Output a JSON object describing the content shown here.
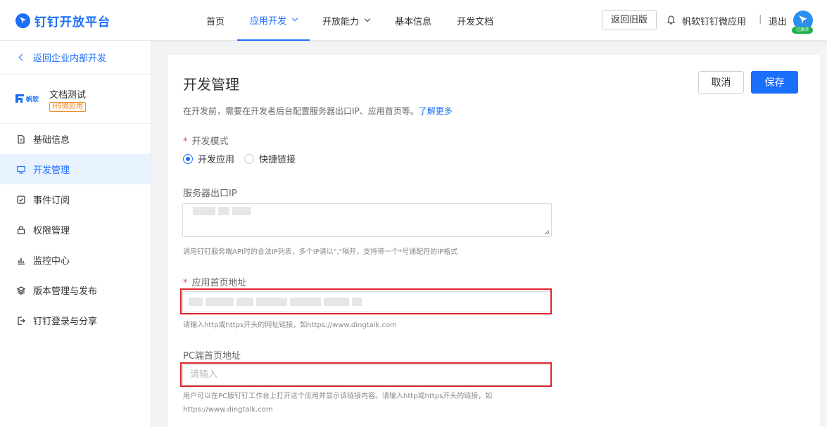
{
  "header": {
    "logo_text": "钉钉开放平台",
    "nav": [
      {
        "label": "首页",
        "active": false,
        "has_dropdown": false
      },
      {
        "label": "应用开发",
        "active": true,
        "has_dropdown": true
      },
      {
        "label": "开放能力",
        "active": false,
        "has_dropdown": true
      },
      {
        "label": "基本信息",
        "active": false,
        "has_dropdown": false
      },
      {
        "label": "开发文档",
        "active": false,
        "has_dropdown": false
      }
    ],
    "old_version_button": "返回旧版",
    "org_name": "帆软钉钉微应用",
    "separator": "|",
    "logout": "退出",
    "avatar_badge": "已激活"
  },
  "sidebar": {
    "back_label": "返回企业内部开发",
    "app": {
      "name": "文档测试",
      "tag": "H5微应用",
      "logo_text": "帆软"
    },
    "items": [
      {
        "label": "基础信息",
        "icon": "document-icon",
        "active": false
      },
      {
        "label": "开发管理",
        "icon": "monitor-icon",
        "active": true
      },
      {
        "label": "事件订阅",
        "icon": "check-square-icon",
        "active": false
      },
      {
        "label": "权限管理",
        "icon": "lock-icon",
        "active": false
      },
      {
        "label": "监控中心",
        "icon": "bar-chart-icon",
        "active": false
      },
      {
        "label": "版本管理与发布",
        "icon": "layers-icon",
        "active": false
      },
      {
        "label": "钉钉登录与分享",
        "icon": "share-icon",
        "active": false
      }
    ]
  },
  "main": {
    "title": "开发管理",
    "cancel_label": "取消",
    "save_label": "保存",
    "description": "在开发前，需要在开发者后台配置服务器出口IP、应用首页等。",
    "learn_more": "了解更多",
    "dev_mode": {
      "label": "开发模式",
      "required_mark": "*",
      "options": [
        {
          "label": "开发应用",
          "selected": true
        },
        {
          "label": "快捷链接",
          "selected": false
        }
      ]
    },
    "server_ip": {
      "label": "服务器出口IP",
      "hint": "调用钉钉服务端API时的合法IP列表，多个IP请以\",\"隔开，支持带一个*号通配符的IP格式"
    },
    "homepage": {
      "label": "应用首页地址",
      "required_mark": "*",
      "hint": "请输入http或https开头的网址链接，如https://www.dingtalk.com"
    },
    "pc_homepage": {
      "label": "PC端首页地址",
      "placeholder": "请输入",
      "hint": "用户可以在PC版钉钉工作台上打开这个应用并显示该链接内容。请输入http或https开头的链接，如https://www.dingtalk.com"
    }
  },
  "colors": {
    "accent": "#1a6efc",
    "highlight_box": "#e0252b",
    "required": "#e34d4d",
    "tag": "#f08c2a"
  }
}
